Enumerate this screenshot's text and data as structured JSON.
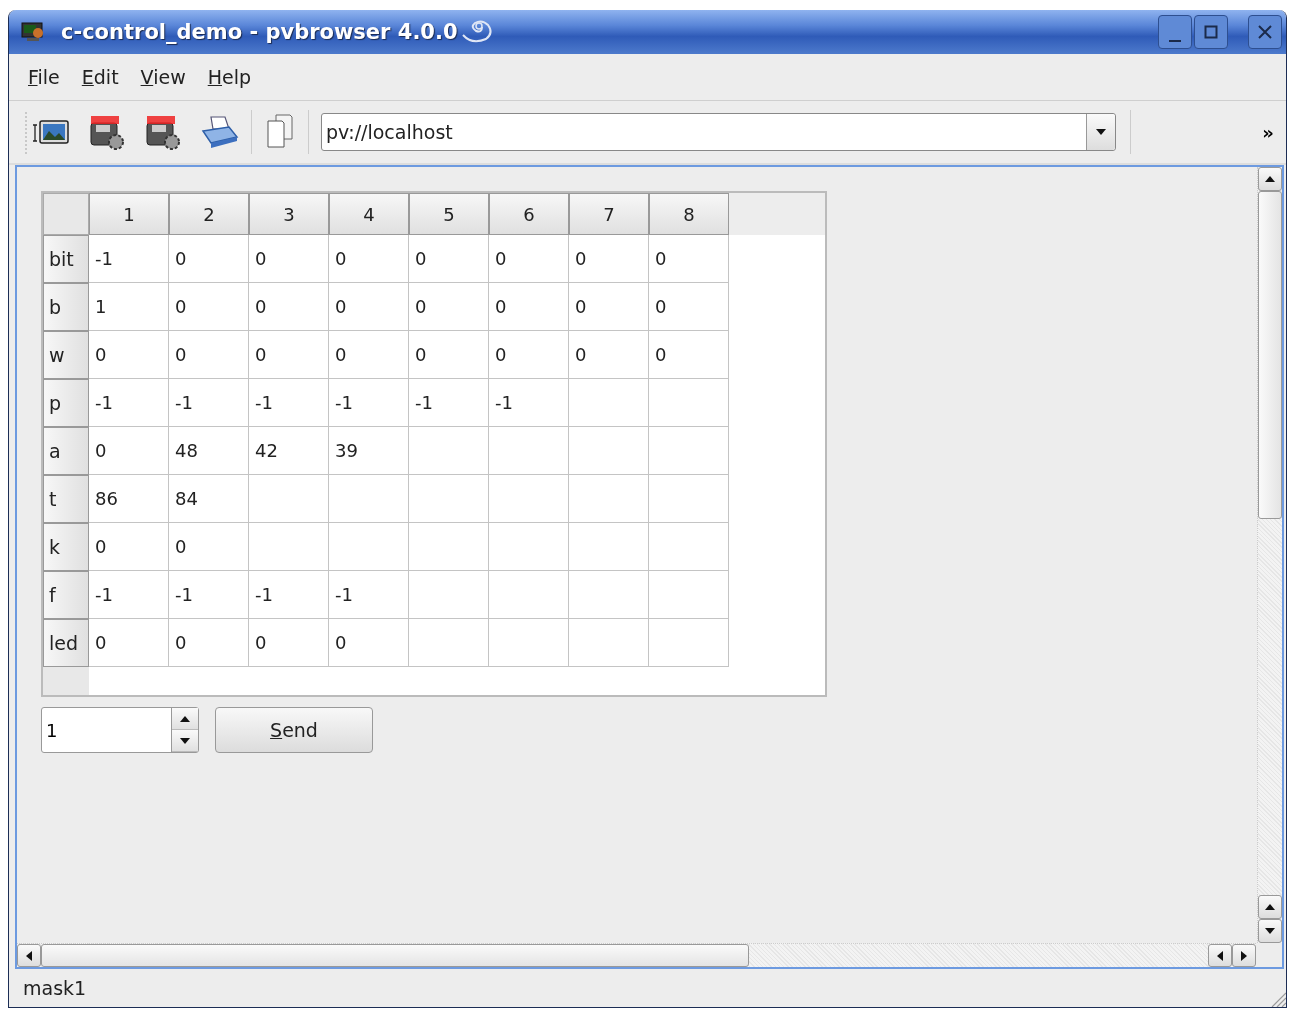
{
  "window": {
    "title": "c-control_demo - pvbrowser 4.0.0"
  },
  "menu": [
    {
      "label": "File"
    },
    {
      "label": "Edit"
    },
    {
      "label": "View"
    },
    {
      "label": "Help"
    }
  ],
  "toolbar": {
    "address": "pv://localhost",
    "overflow": "»"
  },
  "table": {
    "columns": [
      "1",
      "2",
      "3",
      "4",
      "5",
      "6",
      "7",
      "8"
    ],
    "rows": [
      {
        "label": "bit",
        "cells": [
          "-1",
          "0",
          "0",
          "0",
          "0",
          "0",
          "0",
          "0"
        ]
      },
      {
        "label": "b",
        "cells": [
          "1",
          "0",
          "0",
          "0",
          "0",
          "0",
          "0",
          "0"
        ]
      },
      {
        "label": "w",
        "cells": [
          "0",
          "0",
          "0",
          "0",
          "0",
          "0",
          "0",
          "0"
        ]
      },
      {
        "label": "p",
        "cells": [
          "-1",
          "-1",
          "-1",
          "-1",
          "-1",
          "-1"
        ]
      },
      {
        "label": "a",
        "cells": [
          "0",
          "48",
          "42",
          "39"
        ]
      },
      {
        "label": "t",
        "cells": [
          "86",
          "84"
        ]
      },
      {
        "label": "k",
        "cells": [
          "0",
          "0"
        ]
      },
      {
        "label": "f",
        "cells": [
          "-1",
          "-1",
          "-1",
          "-1"
        ]
      },
      {
        "label": "led",
        "cells": [
          "0",
          "0",
          "0",
          "0"
        ]
      }
    ]
  },
  "spinbox": {
    "value": "1"
  },
  "send_button": {
    "label": "Send"
  },
  "status_bar": {
    "text": "mask1"
  }
}
